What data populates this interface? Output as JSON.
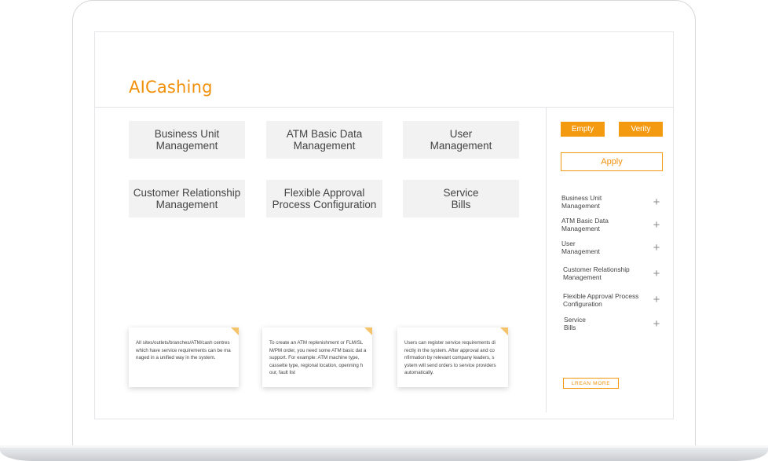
{
  "app": {
    "title": "AICashing"
  },
  "tiles": [
    {
      "label": "Business Unit\nManagement"
    },
    {
      "label": "ATM Basic Data\nManagement"
    },
    {
      "label": "User\nManagement"
    },
    {
      "label": "Customer Relationship\nManagement"
    },
    {
      "label": "Flexible Approval\nProcess Configuration"
    },
    {
      "label": "Service\nBills"
    }
  ],
  "cards": [
    {
      "text": "All sites/outlets/branches/ATM/cash centres which have service requirements can be ma naged in a unified way in the system."
    },
    {
      "text": "To create an ATM replenishment or FLM/SL M/PM order, you need some ATM basic dat a support. For example: ATM machine type, cassette type, regional location, openning h our, fault list"
    },
    {
      "text": "Users can register service requirements di rectly in the system. After approval and co nfirmation by relevant company leaders, s ystem will send orders to service providers automatically."
    }
  ],
  "panel": {
    "empty_label": "Empty",
    "verify_label": "Verity",
    "apply_label": "Apply",
    "items": [
      {
        "label": "Business Unit\nManagement"
      },
      {
        "label": "ATM Basic Data\nManagement"
      },
      {
        "label": "User\nManagement"
      },
      {
        "label": "Customer Relationship\nManagement"
      },
      {
        "label": "Flexible Approval Process\nConfiguration"
      },
      {
        "label": "Service\nBills"
      }
    ],
    "plus_icon": "+",
    "learn_more_label": "LREAN MORE"
  },
  "colors": {
    "accent": "#f39a11",
    "tile_bg": "#f2f2f2",
    "card_corner": "#f5c46a"
  }
}
